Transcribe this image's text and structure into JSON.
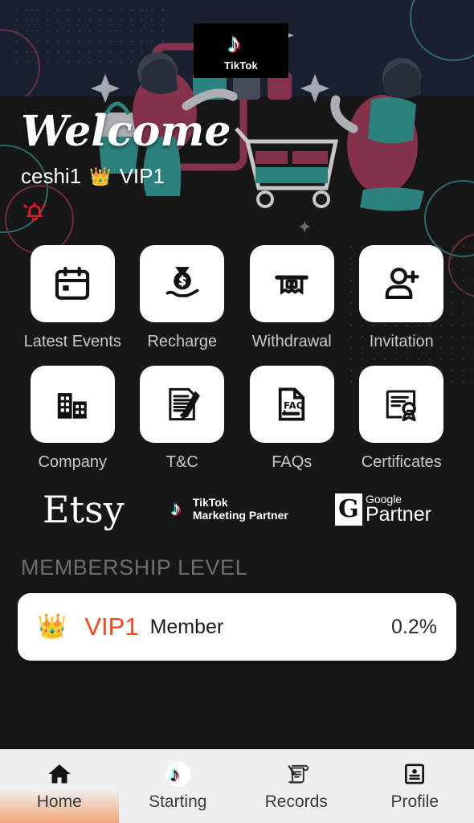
{
  "header": {
    "tiktok_label": "TikTok",
    "tiktok_chip_icon": "tiktok-note-icon"
  },
  "welcome": {
    "title": "Welcome",
    "username": "ceshi1",
    "vip_badge_icon": "crown-icon",
    "vip_badge_glyph": "👑",
    "vip_level": "VIP1",
    "bell_icon": "notification-bell-icon"
  },
  "menu": {
    "items": [
      {
        "label": "Latest Events",
        "icon": "calendar-icon"
      },
      {
        "label": "Recharge",
        "icon": "money-bag-hand-icon"
      },
      {
        "label": "Withdrawal",
        "icon": "atm-cash-icon"
      },
      {
        "label": "Invitation",
        "icon": "person-add-icon"
      },
      {
        "label": "Company",
        "icon": "buildings-icon"
      },
      {
        "label": "T&C",
        "icon": "signed-document-icon"
      },
      {
        "label": "FAQs",
        "icon": "faq-document-icon"
      },
      {
        "label": "Certificates",
        "icon": "certificate-ribbon-icon"
      }
    ]
  },
  "partners": {
    "etsy": "Etsy",
    "tiktok_line1": "TikTok",
    "tiktok_line2": "Marketing Partner",
    "google_mark": "G",
    "google_line1": "Google",
    "google_line2": "Partner"
  },
  "membership": {
    "heading": "MEMBERSHIP LEVEL",
    "crown_glyph": "👑",
    "level": "VIP1",
    "name": "Member",
    "rate": "0.2%",
    "level_color": "#ff4516"
  },
  "bottom_nav": {
    "items": [
      {
        "label": "Home",
        "icon": "home-icon",
        "active": true
      },
      {
        "label": "Starting",
        "icon": "tiktok-note-icon",
        "active": false
      },
      {
        "label": "Records",
        "icon": "scroll-quill-icon",
        "active": false
      },
      {
        "label": "Profile",
        "icon": "id-card-icon",
        "active": false
      }
    ]
  }
}
